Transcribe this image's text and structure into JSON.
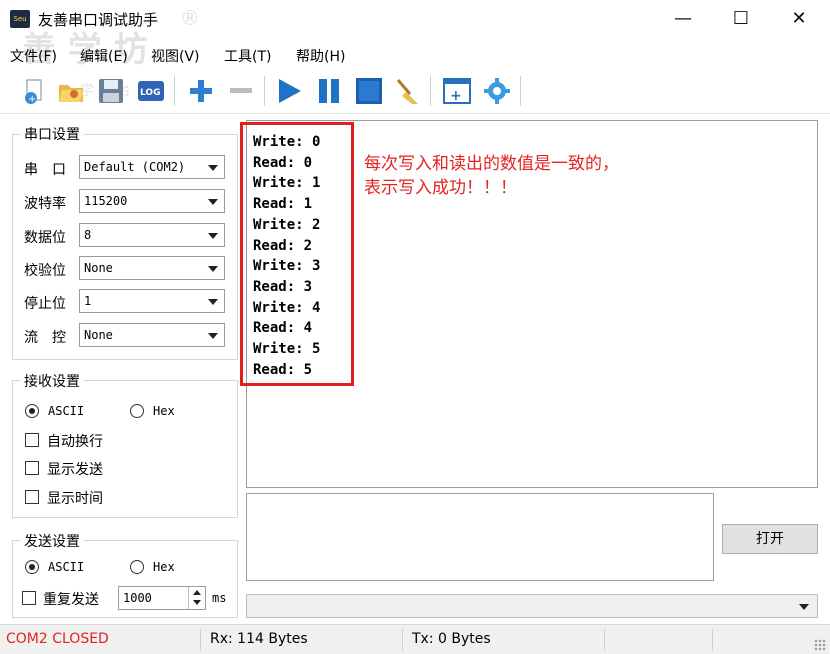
{
  "window": {
    "title": "友善串口调试助手",
    "icon_text": "Seu",
    "trademark": "®",
    "minimize": "—",
    "maximize": "☐",
    "close": "✕"
  },
  "watermark": {
    "text1": "善 学 坊",
    "text2": "学 平 台"
  },
  "menu": [
    "文件(F)",
    "编辑(E)",
    "视图(V)",
    "工具(T)",
    "帮助(H)"
  ],
  "toolbar": {
    "log_label": "LOG",
    "icons": [
      "new-file-icon",
      "open-folder-icon",
      "save-icon",
      "log-icon",
      "add-icon",
      "remove-icon",
      "play-icon",
      "pause-icon",
      "stop-icon",
      "broom-icon",
      "new-window-icon",
      "settings-gear-icon"
    ]
  },
  "serial": {
    "group_title": "串口设置",
    "port_label": "串　口",
    "port_value": "Default (COM2)",
    "baud_label": "波特率",
    "baud_value": "115200",
    "databits_label": "数据位",
    "databits_value": "8",
    "parity_label": "校验位",
    "parity_value": "None",
    "stopbits_label": "停止位",
    "stopbits_value": "1",
    "flow_label": "流　控",
    "flow_value": "None"
  },
  "receive": {
    "group_title": "接收设置",
    "ascii_label": "ASCII",
    "hex_label": "Hex",
    "mode_selected": "ASCII",
    "auto_newline": "自动换行",
    "show_send": "显示发送",
    "show_time": "显示时间"
  },
  "send": {
    "group_title": "发送设置",
    "ascii_label": "ASCII",
    "hex_label": "Hex",
    "mode_selected": "ASCII",
    "repeat_label": "重复发送",
    "interval_value": "1000",
    "interval_unit": "ms",
    "open_button": "打开"
  },
  "recv_text": "Write: 0\nRead: 0\nWrite: 1\nRead: 1\nWrite: 2\nRead: 2\nWrite: 3\nRead: 3\nWrite: 4\nRead: 4\nWrite: 5\nRead: 5",
  "annotation": "每次写入和读出的数值是一致的，\n表示写入成功！！！",
  "status": {
    "port_state": "COM2 CLOSED",
    "rx": "Rx: 114 Bytes",
    "tx": "Tx: 0 Bytes"
  },
  "colors": {
    "status_closed": "#e52222",
    "annotation": "#e52222",
    "highlight_border": "#e02020",
    "play_blue": "#1e73c8"
  }
}
